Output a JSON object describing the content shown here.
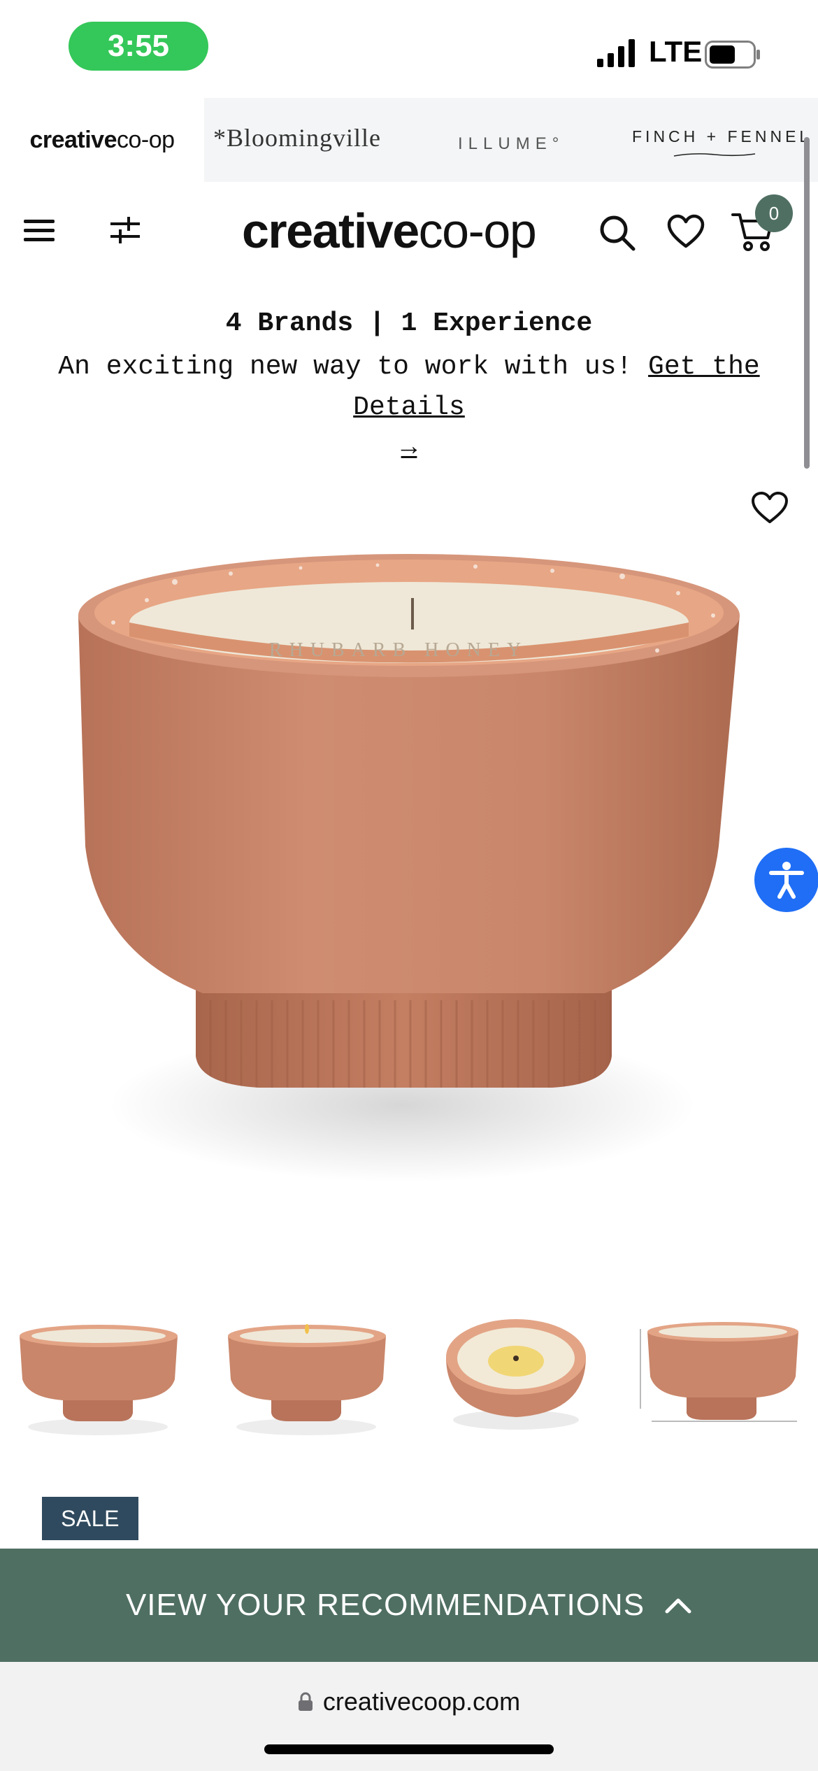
{
  "status_bar": {
    "time": "3:55",
    "network": "LTE"
  },
  "brand_bar": {
    "brands": [
      {
        "name_bold": "creative",
        "name_light": "co-op",
        "active": true
      },
      {
        "name": "*Bloomingville"
      },
      {
        "name": "ILLUME°"
      },
      {
        "name": "FINCH + FENNEL"
      }
    ]
  },
  "header": {
    "logo_bold": "creative",
    "logo_light": "co-op",
    "cart_count": "0"
  },
  "announcement": {
    "title": "4 Brands | 1 Experience",
    "message": "An exciting new way to work with us! ",
    "link_text": "Get the Details",
    "arrow": "→"
  },
  "product": {
    "label_text": "RHUBARB HONEY",
    "badge": "SALE"
  },
  "recommendations": {
    "label": "VIEW YOUR RECOMMENDATIONS"
  },
  "browser": {
    "url": "creativecoop.com"
  },
  "colors": {
    "brand_green": "#4f6f62",
    "sale_navy": "#2f4a5e",
    "status_green": "#34c759",
    "accessibility_blue": "#1f6ef5",
    "terracotta": "#c98469"
  },
  "icons": [
    "menu-icon",
    "filter-icon",
    "search-icon",
    "heart-icon",
    "cart-icon",
    "accessibility-icon",
    "chevron-up-icon",
    "lock-icon"
  ]
}
